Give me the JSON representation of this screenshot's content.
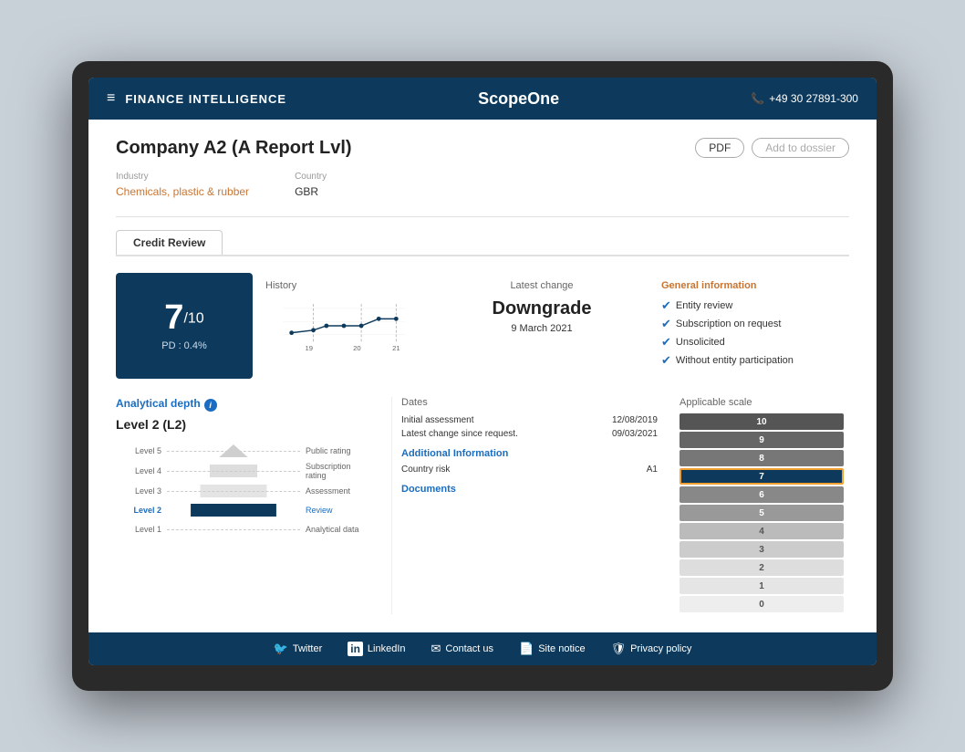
{
  "laptop": {},
  "topNav": {
    "menu_icon": "≡",
    "title": "FINANCE INTELLIGENCE",
    "logo": "ScopeOne",
    "phone_icon": "📞",
    "phone": "+49 30 27891-300"
  },
  "pageHeader": {
    "title": "Company A2 (A Report Lvl)",
    "pdf_btn": "PDF",
    "dossier_btn": "Add to dossier"
  },
  "meta": {
    "industry_label": "Industry",
    "industry_value": "Chemicals, plastic & rubber",
    "country_label": "Country",
    "country_value": "GBR"
  },
  "tabs": [
    {
      "label": "Credit Review",
      "active": true
    }
  ],
  "rating": {
    "number": "7",
    "denom": "/10",
    "pd_label": "PD : 0.4%"
  },
  "history": {
    "label": "History",
    "year_labels": [
      "19",
      "20",
      "21"
    ]
  },
  "latestChange": {
    "label": "Latest change",
    "value": "Downgrade",
    "date": "9 March 2021"
  },
  "generalInfo": {
    "title": "General information",
    "items": [
      "Entity review",
      "Subscription on request",
      "Unsolicited",
      "Without entity participation"
    ]
  },
  "analyticalDepth": {
    "title": "Analytical depth",
    "subtitle": "Level 2 (L2)",
    "levels": [
      {
        "label": "Level 5",
        "right": "Public rating",
        "active": false
      },
      {
        "label": "Level 4",
        "right": "Subscription rating",
        "active": false
      },
      {
        "label": "Level 3",
        "right": "Assessment",
        "active": false
      },
      {
        "label": "Level 2",
        "right": "Review",
        "active": true,
        "right_link": true
      },
      {
        "label": "Level 1",
        "right": "Analytical data",
        "active": false
      }
    ]
  },
  "dates": {
    "title": "Dates",
    "initial_label": "Initial assessment",
    "initial_value": "12/08/2019",
    "latest_label": "Latest change since request.",
    "latest_value": "09/03/2021",
    "addInfo_title": "Additional Information",
    "country_risk_label": "Country risk",
    "country_risk_value": "A1",
    "docs_title": "Documents"
  },
  "scale": {
    "title": "Applicable scale",
    "bars": [
      {
        "value": "10",
        "active": true,
        "color": "#555"
      },
      {
        "value": "9",
        "active": false,
        "color": "#666"
      },
      {
        "value": "8",
        "active": false,
        "color": "#777"
      },
      {
        "value": "7",
        "active": true,
        "color": "#0d3a5c"
      },
      {
        "value": "6",
        "active": false,
        "color": "#888"
      },
      {
        "value": "5",
        "active": false,
        "color": "#999"
      },
      {
        "value": "4",
        "active": false,
        "color": "#bbb"
      },
      {
        "value": "3",
        "active": false,
        "color": "#ccc"
      },
      {
        "value": "2",
        "active": false,
        "color": "#ddd"
      },
      {
        "value": "1",
        "active": false,
        "color": "#e5e5e5"
      },
      {
        "value": "0",
        "active": false,
        "color": "#eee"
      }
    ]
  },
  "footer": {
    "links": [
      {
        "icon": "🐦",
        "label": "Twitter"
      },
      {
        "icon": "in",
        "label": "LinkedIn"
      },
      {
        "icon": "✉",
        "label": "Contact us"
      },
      {
        "icon": "📄",
        "label": "Site notice"
      },
      {
        "icon": "🛡",
        "label": "Privacy policy"
      }
    ]
  }
}
